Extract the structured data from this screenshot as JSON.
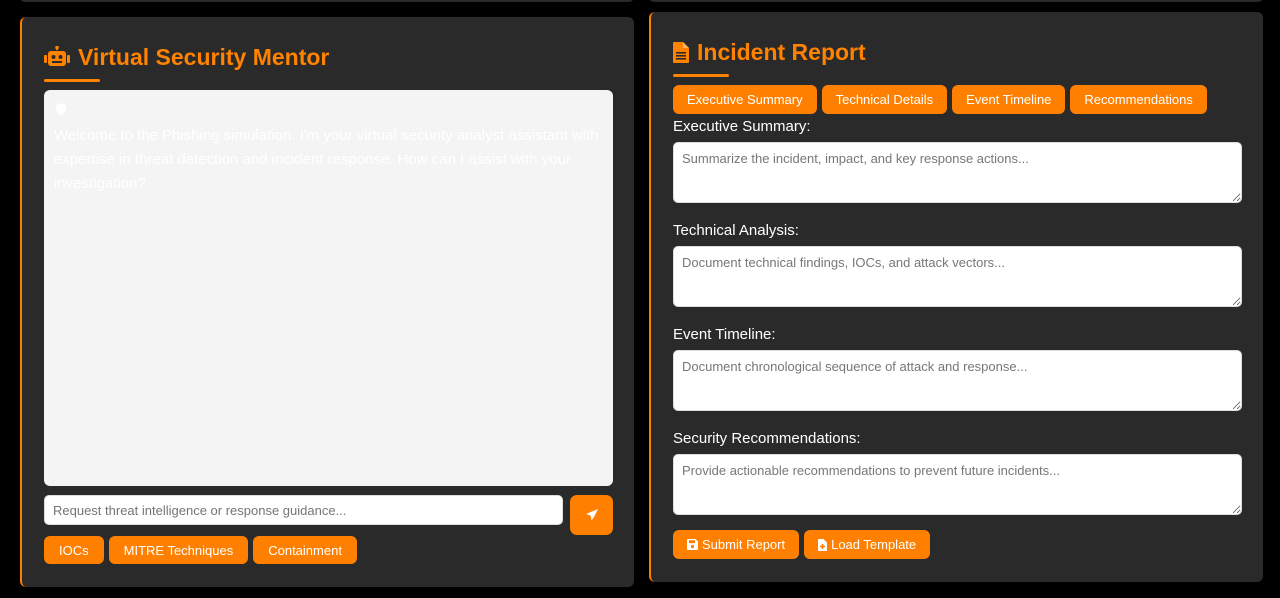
{
  "colors": {
    "accent": "#ff8000",
    "panel": "#2a2a2a",
    "background": "#000000"
  },
  "mentor": {
    "title": "Virtual Security Mentor",
    "title_icon": "robot-icon",
    "message": "Welcome to the Phishing simulation. I'm your virtual security analyst assistant with expertise in threat detection and incident response. How can I assist with your investigation?",
    "message_icon": "shield-icon",
    "input_placeholder": "Request threat intelligence or response guidance...",
    "send_icon": "paper-plane-icon",
    "quick_actions": [
      "IOCs",
      "MITRE Techniques",
      "Containment"
    ]
  },
  "report": {
    "title": "Incident Report",
    "title_icon": "file-icon",
    "tabs": [
      "Executive Summary",
      "Technical Details",
      "Event Timeline",
      "Recommendations"
    ],
    "fields": [
      {
        "label": "Executive Summary:",
        "placeholder": "Summarize the incident, impact, and key response actions..."
      },
      {
        "label": "Technical Analysis:",
        "placeholder": "Document technical findings, IOCs, and attack vectors..."
      },
      {
        "label": "Event Timeline:",
        "placeholder": "Document chronological sequence of attack and response..."
      },
      {
        "label": "Security Recommendations:",
        "placeholder": "Provide actionable recommendations to prevent future incidents..."
      }
    ],
    "submit_label": "Submit Report",
    "submit_icon": "save-icon",
    "load_label": "Load Template",
    "load_icon": "file-import-icon"
  }
}
